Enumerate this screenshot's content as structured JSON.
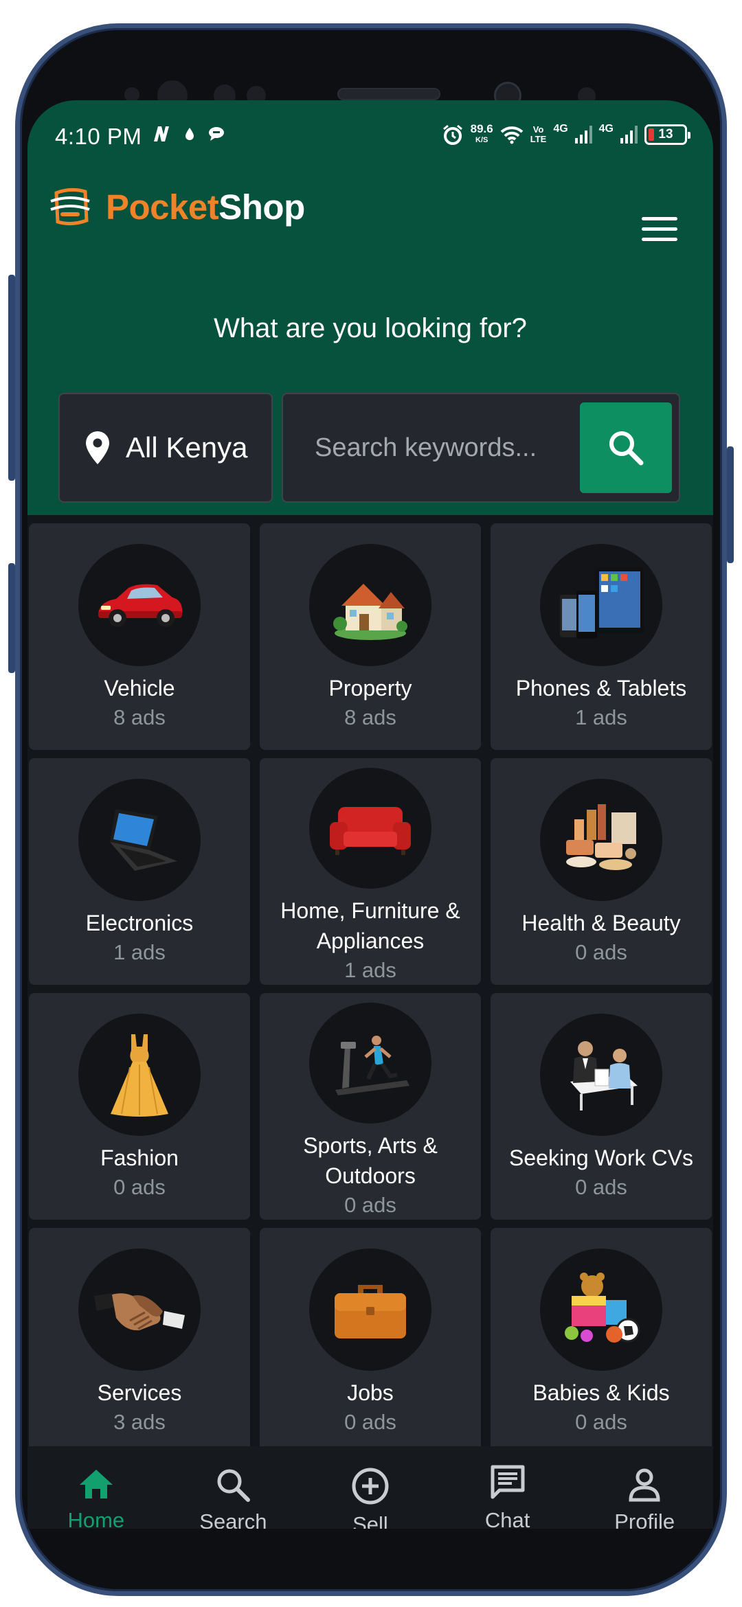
{
  "status_bar": {
    "time": "4:10 PM",
    "speed_value": "89.6",
    "speed_unit": "K/S",
    "volte_top": "Vo",
    "volte_bottom": "LTE",
    "sim1_net": "4G",
    "sim2_net": "4G",
    "battery": "13"
  },
  "header": {
    "brand_part1": "Pocket",
    "brand_part2": "Shop",
    "prompt": "What are you looking for?",
    "location": "All Kenya",
    "search_placeholder": "Search keywords..."
  },
  "categories": [
    {
      "title": "Vehicle",
      "count": "8 ads",
      "icon": "car-icon"
    },
    {
      "title": "Property",
      "count": "8 ads",
      "icon": "house-icon"
    },
    {
      "title": "Phones & Tablets",
      "count": "1 ads",
      "icon": "phones-tablets-icon"
    },
    {
      "title": "Electronics",
      "count": "1 ads",
      "icon": "laptop-icon"
    },
    {
      "title": "Home, Furniture & Appliances",
      "count": "1 ads",
      "icon": "sofa-icon"
    },
    {
      "title": "Health & Beauty",
      "count": "0 ads",
      "icon": "cosmetics-icon"
    },
    {
      "title": "Fashion",
      "count": "0 ads",
      "icon": "dress-icon"
    },
    {
      "title": "Sports, Arts & Outdoors",
      "count": "0 ads",
      "icon": "treadmill-icon"
    },
    {
      "title": "Seeking Work CVs",
      "count": "0 ads",
      "icon": "interview-icon"
    },
    {
      "title": "Services",
      "count": "3 ads",
      "icon": "handshake-icon"
    },
    {
      "title": "Jobs",
      "count": "0 ads",
      "icon": "briefcase-icon"
    },
    {
      "title": "Babies & Kids",
      "count": "0 ads",
      "icon": "toys-icon"
    }
  ],
  "bottom_nav": [
    {
      "label": "Home",
      "icon": "home-icon",
      "active": true
    },
    {
      "label": "Search",
      "icon": "search-icon",
      "active": false
    },
    {
      "label": "Sell",
      "icon": "plus-circle-icon",
      "active": false
    },
    {
      "label": "Chat",
      "icon": "chat-icon",
      "active": false
    },
    {
      "label": "Profile",
      "icon": "profile-icon",
      "active": false
    }
  ],
  "colors": {
    "header_green": "#07523d",
    "brand_orange": "#f0832a",
    "accent_green": "#0e8f62",
    "card_bg": "#272b31"
  }
}
